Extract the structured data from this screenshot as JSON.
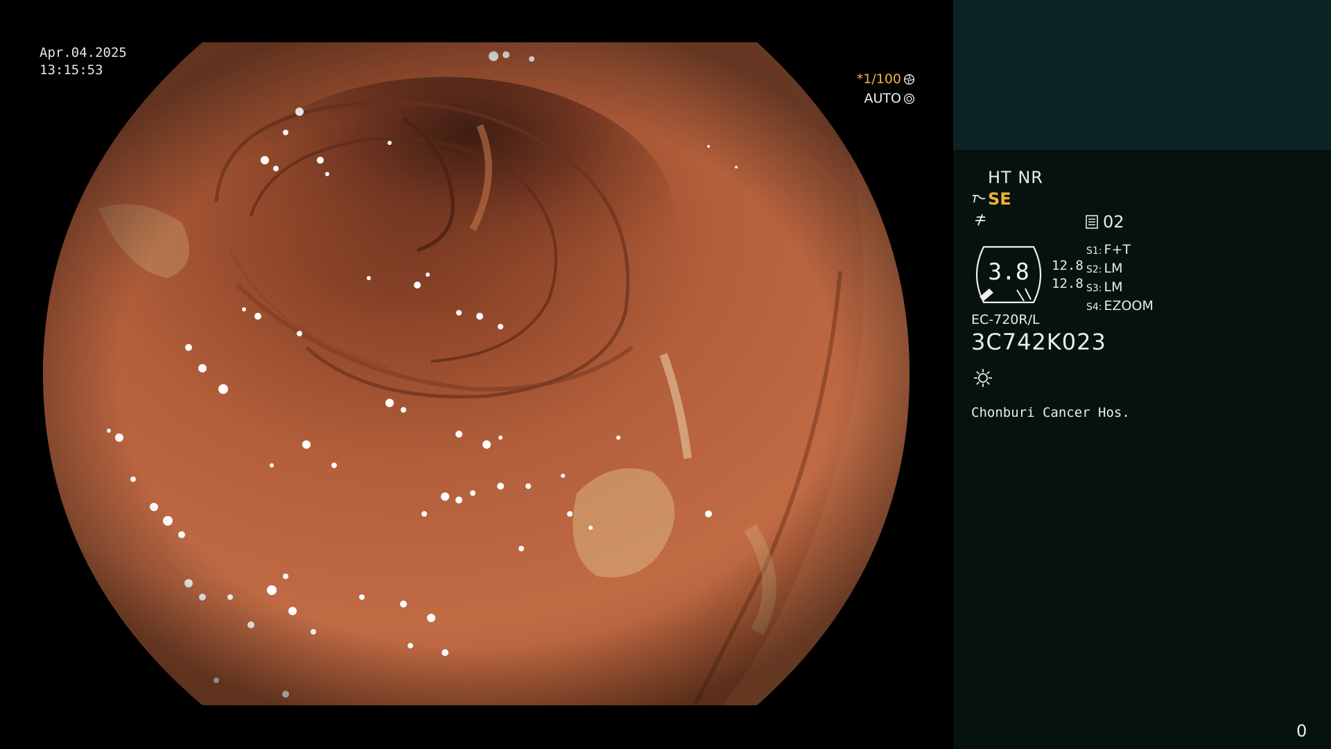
{
  "overlay": {
    "date": "Apr.04.2025",
    "time": "13:15:53",
    "shutter_speed": "*1/100",
    "iris_mode": "AUTO",
    "shutter_icon": "shutter-icon",
    "iris_icon": "iris-icon"
  },
  "panel": {
    "enhancement": "HT NR",
    "structure_enhancement": "SE",
    "structure_icon": "structure-enhance-icon",
    "filter_icon": "filter-icon",
    "memory_icon": "memory-card-icon",
    "memory_slot": "02",
    "zoom_value": "3.8",
    "gauge_values": [
      "12.8",
      "12.8"
    ],
    "switches": [
      {
        "key": "S1:",
        "value": "F+T"
      },
      {
        "key": "S2:",
        "value": "LM"
      },
      {
        "key": "S3:",
        "value": "LM"
      },
      {
        "key": "S4:",
        "value": "EZOOM"
      }
    ],
    "scope_model": "EC-720R/L",
    "serial_number": "3C742K023",
    "light_icon": "light-source-icon",
    "hospital": "Chonburi Cancer Hos.",
    "counter": "0"
  },
  "colors": {
    "accent": "#f2b233",
    "panel_top": "#0d2425",
    "panel_bg": "#051210",
    "mucosa": "#b8623c"
  }
}
